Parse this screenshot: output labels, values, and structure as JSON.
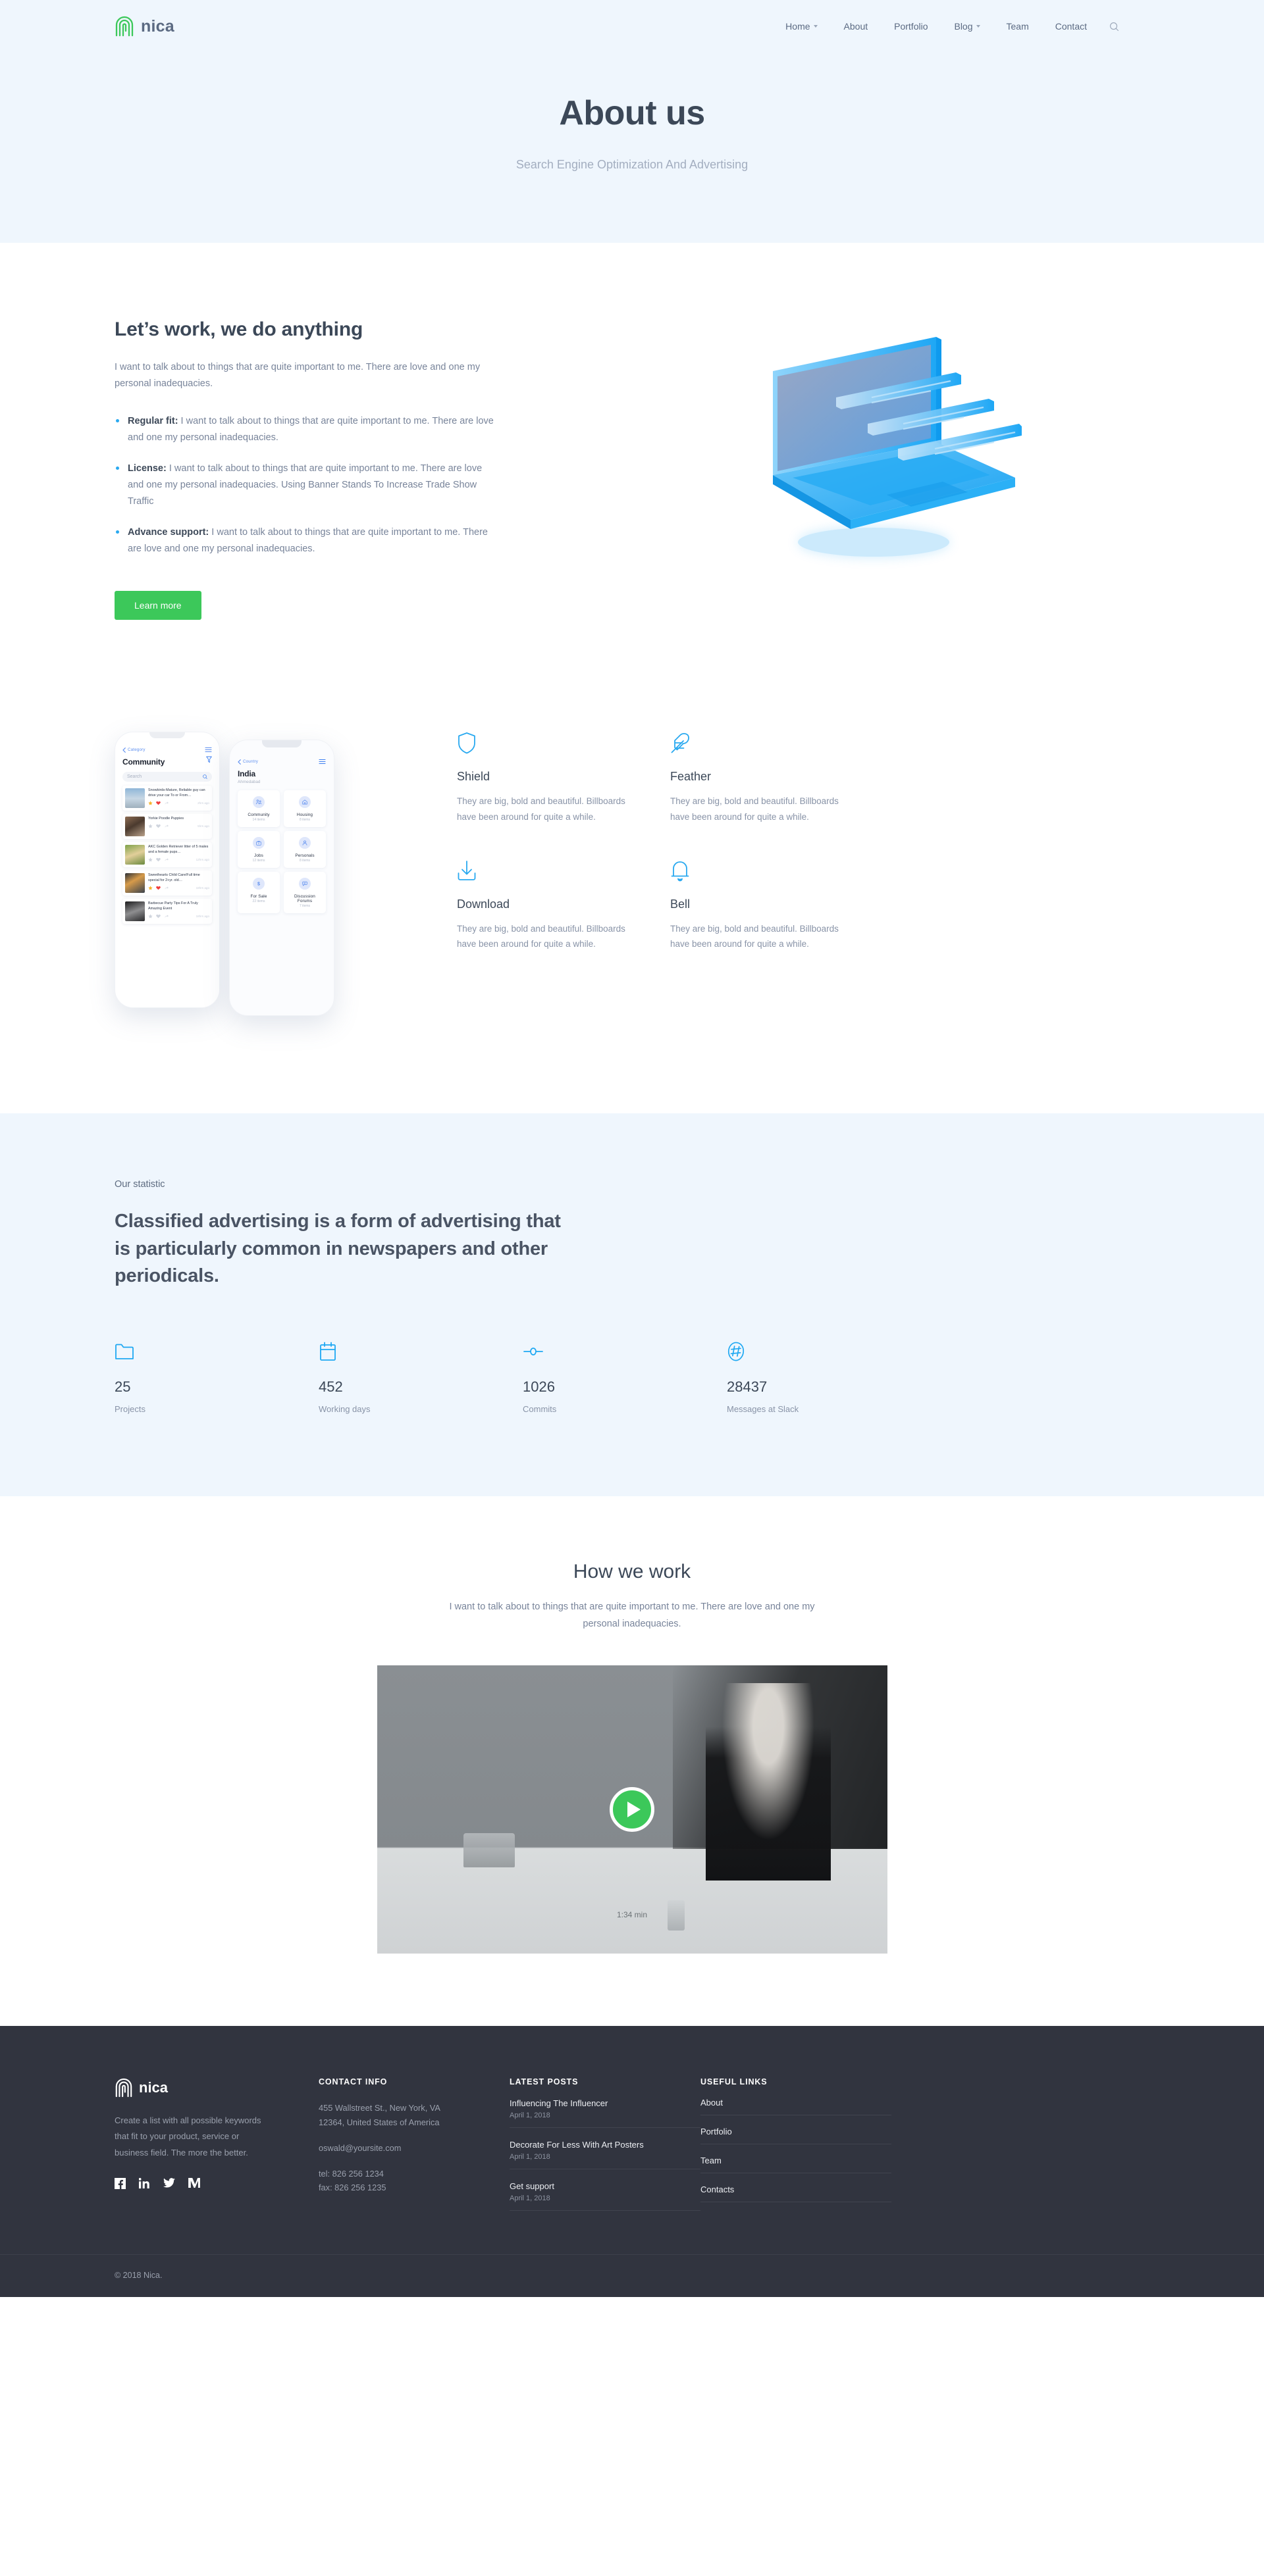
{
  "brand": {
    "name": "nica",
    "logo_icon": "fingerprint-logo-icon"
  },
  "nav": {
    "items": [
      {
        "label": "Home",
        "has_dropdown": true
      },
      {
        "label": "About",
        "has_dropdown": false
      },
      {
        "label": "Portfolio",
        "has_dropdown": false
      },
      {
        "label": "Blog",
        "has_dropdown": true
      },
      {
        "label": "Team",
        "has_dropdown": false
      },
      {
        "label": "Contact",
        "has_dropdown": false
      }
    ],
    "search_icon": "search-icon"
  },
  "hero": {
    "title": "About us",
    "subtitle": "Search Engine Optimization And Advertising",
    "background": "#eff6fd"
  },
  "work": {
    "heading": "Let’s work, we do anything",
    "lead": "I want to talk about to things that are quite important to me. There are love and one my personal inadequacies.",
    "bullets": [
      {
        "term": "Regular fit:",
        "text": " I want to talk about to things that are quite important to me. There are love and one my personal inadequacies."
      },
      {
        "term": "License:",
        "text": " I want to talk about to things that are quite important to me. There are love and one my personal inadequacies. Using Banner Stands To Increase Trade Show Traffic"
      },
      {
        "term": "Advance support:",
        "text": " I want to talk about to things that are quite important to me. There are love and one my personal inadequacies."
      }
    ],
    "button_label": "Learn more",
    "button_color": "#3cc85a",
    "illustration": "isometric-laptop-illustration"
  },
  "features": [
    {
      "icon": "shield-icon",
      "title": "Shield",
      "text": "They are big, bold and beautiful. Billboards have been around for quite a while."
    },
    {
      "icon": "feather-icon",
      "title": "Feather",
      "text": "They are big, bold and beautiful. Billboards have been around for quite a while."
    },
    {
      "icon": "download-icon",
      "title": "Download",
      "text": "They are big, bold and beautiful. Billboards have been around for quite a while."
    },
    {
      "icon": "bell-icon",
      "title": "Bell",
      "text": "They are big, bold and beautiful. Billboards have been around for quite a while."
    }
  ],
  "accent_blue": "#29a9f0",
  "phone_one": {
    "back_label": "Category",
    "title": "Community",
    "search_placeholder": "Search",
    "posts": [
      {
        "title": "Snowbirds-Mature, Reliable guy can drive your car To or From…",
        "time": "2hrs ago",
        "starred": true,
        "liked": true
      },
      {
        "title": "Yorkie Poodle Puppies",
        "time": "5hrs ago",
        "starred": false,
        "liked": false
      },
      {
        "title": "AKC Golden Retriever litter of 5 males and a female pups…",
        "time": "12hrs ago",
        "starred": false,
        "liked": false
      },
      {
        "title": "Sweethearts Child Care/Full time special for 2+yr. old…",
        "time": "18hrs ago",
        "starred": true,
        "liked": true
      },
      {
        "title": "Barbecue Party Tips For A Truly Amazing Event",
        "time": "18hrs ago",
        "starred": false,
        "liked": false
      }
    ]
  },
  "phone_two": {
    "back_label": "Country",
    "title": "India",
    "subtitle": "Ahmedabad",
    "tiles": [
      {
        "icon": "people-icon",
        "name": "Community",
        "items": "14 items"
      },
      {
        "icon": "home-icon",
        "name": "Housing",
        "items": "8 items"
      },
      {
        "icon": "briefcase-icon",
        "name": "Jobs",
        "items": "12 items"
      },
      {
        "icon": "person-icon",
        "name": "Personals",
        "items": "8 items"
      },
      {
        "icon": "dollar-icon",
        "name": "For Sale",
        "items": "22 items"
      },
      {
        "icon": "chat-icon",
        "name": "Discussion Forums",
        "items": "7 items"
      }
    ]
  },
  "statistic": {
    "kicker": "Our statistic",
    "heading": "Classified advertising is a form of advertising that is particularly common in newspapers and other periodicals.",
    "items": [
      {
        "icon": "folder-icon",
        "value": "25",
        "label": "Projects"
      },
      {
        "icon": "calendar-icon",
        "value": "452",
        "label": "Working days"
      },
      {
        "icon": "commit-icon",
        "value": "1026",
        "label": "Commits"
      },
      {
        "icon": "slack-hash-icon",
        "value": "28437",
        "label": "Messages at Slack"
      }
    ]
  },
  "how": {
    "heading": "How we work",
    "lead": "I want to talk about to things that are quite important to me. There are love and one my personal inadequacies.",
    "duration": "1:34 min",
    "play_icon": "play-icon"
  },
  "footer": {
    "brand_name": "nica",
    "description": "Create a list with all possible keywords that fit to your product, service or business field. The more the better.",
    "social": [
      {
        "icon": "facebook-icon",
        "name": "Facebook"
      },
      {
        "icon": "linkedin-icon",
        "name": "LinkedIn"
      },
      {
        "icon": "twitter-icon",
        "name": "Twitter"
      },
      {
        "icon": "medium-icon",
        "name": "Medium"
      }
    ],
    "contact": {
      "heading": "CONTACT INFO",
      "address": "455 Wallstreet St., New York, VA 12364, United States of America",
      "email": "oswald@yoursite.com",
      "tel": "tel: 826 256 1234",
      "fax": "fax: 826 256 1235"
    },
    "posts": {
      "heading": "LATEST POSTS",
      "items": [
        {
          "title": "Influencing The Influencer",
          "date": "April 1, 2018"
        },
        {
          "title": "Decorate For Less With Art Posters",
          "date": "April 1, 2018"
        },
        {
          "title": "Get support",
          "date": "April 1, 2018"
        }
      ]
    },
    "links": {
      "heading": "USEFUL LINKS",
      "items": [
        "About",
        "Portfolio",
        "Team",
        "Contacts"
      ]
    },
    "copyright": "© 2018 Nica."
  }
}
